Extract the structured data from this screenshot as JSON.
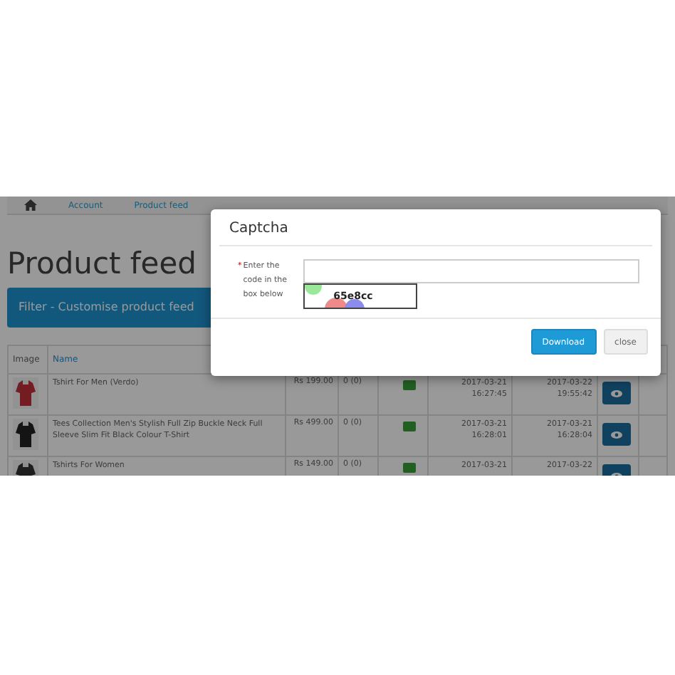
{
  "breadcrumb": [
    {
      "kind": "home"
    },
    {
      "kind": "link",
      "label": "Account"
    },
    {
      "kind": "link",
      "label": "Product feed"
    }
  ],
  "page_title": "Product feed",
  "filter_bar": {
    "label": "Filter - Customise product feed"
  },
  "table": {
    "columns": [
      "Image",
      "Name"
    ],
    "rows": [
      {
        "name": "Tshirt For Men (Verdo)",
        "price": "Rs 199.00",
        "quantity": "0 (0)",
        "enabled": true,
        "date_added": "2017-03-21",
        "time_added": "16:27:45",
        "date_modified": "2017-03-22",
        "time_modified": "19:55:42"
      },
      {
        "name": "Tees Collection Men's Stylish Full Zip Buckle Neck Full Sleeve Slim Fit Black Colour T-Shirt",
        "price": "Rs 499.00",
        "quantity": "0 (0)",
        "enabled": true,
        "date_added": "2017-03-21",
        "time_added": "16:28:01",
        "date_modified": "2017-03-21",
        "time_modified": "16:28:04"
      },
      {
        "name": "Tshirts For Women",
        "price": "Rs 149.00",
        "quantity": "0 (0)",
        "enabled": true,
        "date_added": "2017-03-21",
        "date_modified": "2017-03-22"
      }
    ]
  },
  "modal": {
    "title": "Captcha",
    "field": {
      "label": "Enter the code in the box below",
      "required_mark": "*"
    },
    "captcha_code": "65e8cc",
    "buttons": [
      {
        "label": "Download",
        "kind": "primary"
      },
      {
        "label": "close",
        "kind": "default"
      }
    ]
  }
}
